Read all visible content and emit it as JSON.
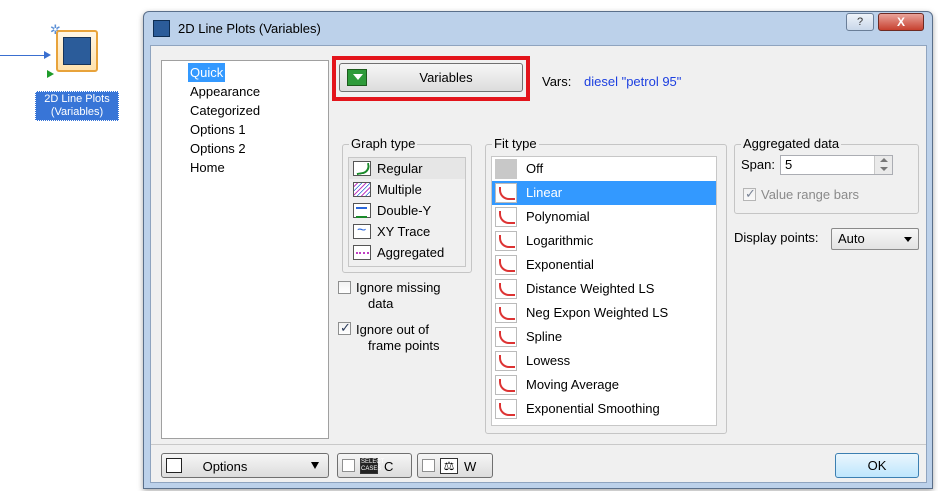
{
  "node": {
    "label": "2D Line Plots (Variables)"
  },
  "window": {
    "title": "2D Line Plots (Variables)",
    "help_glyph": "?",
    "close_glyph": "X"
  },
  "nav": {
    "items": [
      "Quick",
      "Appearance",
      "Categorized",
      "Options 1",
      "Options 2",
      "Home"
    ],
    "selected": "Quick"
  },
  "variables": {
    "button_label": "Variables",
    "vars_label": "Vars:",
    "vars_value": "diesel \"petrol 95\""
  },
  "graph_type": {
    "title": "Graph type",
    "items": [
      "Regular",
      "Multiple",
      "Double-Y",
      "XY Trace",
      "Aggregated"
    ],
    "selected": "Regular"
  },
  "checkboxes": {
    "ignore_missing": {
      "line1": "Ignore missing",
      "line2": "data",
      "checked": false
    },
    "ignore_out": {
      "line1": "Ignore out of",
      "line2": "frame points",
      "checked": true
    }
  },
  "fit_type": {
    "title": "Fit type",
    "items": [
      "Off",
      "Linear",
      "Polynomial",
      "Logarithmic",
      "Exponential",
      "Distance Weighted LS",
      "Neg Expon Weighted LS",
      "Spline",
      "Lowess",
      "Moving Average",
      "Exponential Smoothing"
    ],
    "selected": "Linear"
  },
  "aggregated": {
    "title": "Aggregated data",
    "span_label": "Span:",
    "span_value": "5",
    "value_range_bars": "Value range bars",
    "value_range_checked": true
  },
  "display_points": {
    "label": "Display points:",
    "value": "Auto"
  },
  "bottom": {
    "options_label": "Options",
    "select_cases_icon": "SELECT CASES",
    "select_cases_letter": "C",
    "weight_letter": "W",
    "ok_label": "OK"
  },
  "colors": {
    "accent": "#3399ff",
    "highlight_frame": "#e3141b",
    "vars_text": "#1c3fe0",
    "node_label_bg": "#3875d7"
  }
}
